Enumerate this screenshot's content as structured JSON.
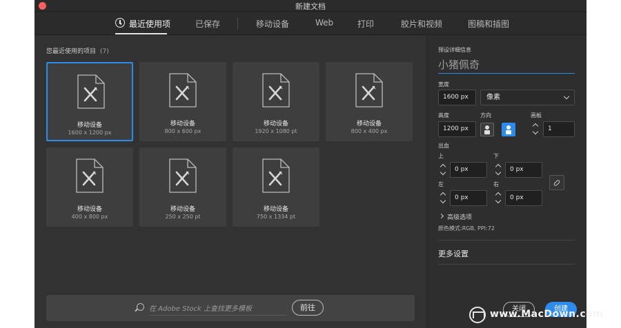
{
  "window": {
    "title": "新建文档"
  },
  "tabs": [
    {
      "label": "最近使用项",
      "active": true
    },
    {
      "label": "已保存"
    },
    {
      "label": "移动设备"
    },
    {
      "label": "Web"
    },
    {
      "label": "打印"
    },
    {
      "label": "胶片和视频"
    },
    {
      "label": "图稿和插图"
    }
  ],
  "recent": {
    "title": "您最近使用的项目",
    "count": "(7)",
    "items": [
      {
        "name": "移动设备",
        "size": "1600 x 1200 px",
        "selected": true
      },
      {
        "name": "移动设备",
        "size": "800 x 600 px"
      },
      {
        "name": "移动设备",
        "size": "1920 x 1080 pt"
      },
      {
        "name": "移动设备",
        "size": "800 x 400 px"
      },
      {
        "name": "移动设备",
        "size": "400 x 800 px"
      },
      {
        "name": "移动设备",
        "size": "250 x 250 pt"
      },
      {
        "name": "移动设备",
        "size": "750 x 1334 pt"
      }
    ]
  },
  "stock": {
    "placeholder": "在 Adobe Stock 上查找更多模板",
    "go_label": "前往"
  },
  "details": {
    "header": "预设详细信息",
    "preset_name": "小猪佩奇",
    "width_label": "宽度",
    "width_value": "1600 px",
    "unit_value": "像素",
    "height_label": "高度",
    "height_value": "1200 px",
    "orientation_label": "方向",
    "artboards_label": "画板",
    "artboards_value": "1",
    "bleed_label": "出血",
    "bleed_top_label": "上",
    "bleed_top_value": "0 px",
    "bleed_bottom_label": "下",
    "bleed_bottom_value": "0 px",
    "bleed_left_label": "左",
    "bleed_left_value": "0 px",
    "bleed_right_label": "右",
    "bleed_right_value": "0 px",
    "advanced_label": "高级选项",
    "color_mode": "颜色模式:RGB, PPI:72",
    "more_settings": "更多设置",
    "close_label": "关闭",
    "create_label": "创建"
  },
  "watermark": {
    "text": "www.MacDown.com"
  },
  "colors": {
    "accent": "#2d8ceb",
    "background": "#323232",
    "panel": "#2e2e2e"
  }
}
